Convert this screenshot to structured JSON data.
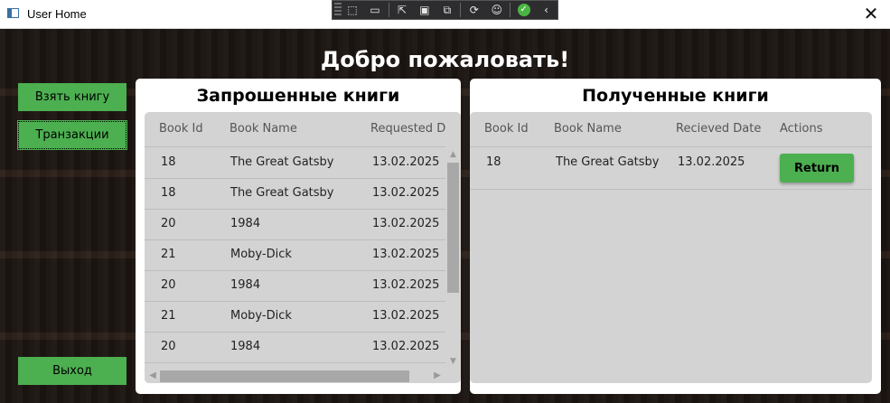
{
  "window": {
    "title": "User Home",
    "close_glyph": "✕"
  },
  "debug_toolbar": {
    "icons": [
      "select-element-icon",
      "record-icon",
      "pointer-select-icon",
      "layout-adorner-icon",
      "display-icon",
      "hot-reload-icon",
      "accessibility-icon",
      "ok-check-icon",
      "collapse-icon"
    ]
  },
  "header": {
    "welcome": "Добро пожаловать!"
  },
  "sidebar": {
    "take_book": "Взять книгу",
    "transactions": "Транзакции",
    "exit": "Выход"
  },
  "requested": {
    "title": "Запрошенные книги",
    "columns": [
      "Book Id",
      "Book Name",
      "Requested Date"
    ],
    "rows": [
      [
        "18",
        "The Great Gatsby",
        "13.02.2025"
      ],
      [
        "18",
        "The Great Gatsby",
        "13.02.2025"
      ],
      [
        "20",
        "1984",
        "13.02.2025"
      ],
      [
        "21",
        "Moby-Dick",
        "13.02.2025"
      ],
      [
        "20",
        "1984",
        "13.02.2025"
      ],
      [
        "21",
        "Moby-Dick",
        "13.02.2025"
      ],
      [
        "20",
        "1984",
        "13.02.2025"
      ]
    ]
  },
  "received": {
    "title": "Полученные книги",
    "columns": [
      "Book Id",
      "Book Name",
      "Recieved Date",
      "Actions"
    ],
    "rows": [
      [
        "18",
        "The Great Gatsby",
        "13.02.2025"
      ]
    ],
    "action_label": "Return"
  },
  "colors": {
    "accent_green": "#4caf50",
    "grid_bg": "#d3d3d3"
  }
}
